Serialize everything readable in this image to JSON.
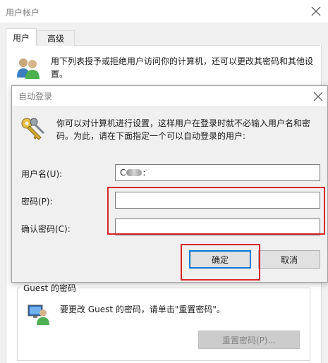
{
  "window": {
    "title": "用户帐户",
    "tabs": [
      {
        "label": "用户"
      },
      {
        "label": "高级"
      }
    ],
    "description": "用下列表授予或拒绝用户访问你的计算机，还可以更改其密码和其他设置。"
  },
  "dialog": {
    "title": "自动登录",
    "description": "你可以对计算机进行设置，这样用户在登录时就不必输入用户名和密码。为此，请在下面指定一个可以自动登录的用户:",
    "username_label": "用户名(U):",
    "username_value_start": "C",
    "username_value_end": ":",
    "password_label": "密码(P):",
    "password_value": "",
    "confirm_label": "确认密码(C):",
    "confirm_value": "",
    "ok_label": "确定",
    "cancel_label": "取消"
  },
  "guest": {
    "group_title": "Guest 的密码",
    "text": "要更改 Guest 的密码，请单击\"重置密码\"。",
    "reset_label": "重置密码(P)..."
  },
  "colors": {
    "highlight": "#d9252a",
    "focus": "#0078d7"
  },
  "icons": [
    "users-icon",
    "keys-icon",
    "user-monitor-icon",
    "close-icon"
  ]
}
